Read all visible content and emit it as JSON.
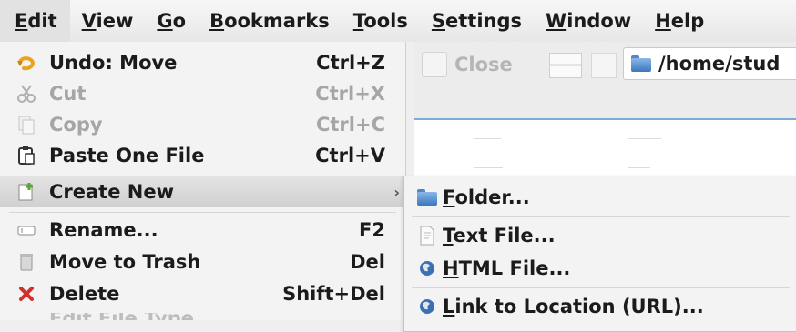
{
  "menubar": {
    "items": [
      "Edit",
      "View",
      "Go",
      "Bookmarks",
      "Tools",
      "Settings",
      "Window",
      "Help"
    ]
  },
  "toolbar": {
    "close_label": "Close",
    "location_path": "/home/stud"
  },
  "edit_menu": {
    "items": [
      {
        "label": "Undo: Move",
        "shortcut": "Ctrl+Z",
        "icon": "undo-icon",
        "enabled": true
      },
      {
        "label": "Cut",
        "shortcut": "Ctrl+X",
        "icon": "scissors-icon",
        "enabled": false
      },
      {
        "label": "Copy",
        "shortcut": "Ctrl+C",
        "icon": "copy-icon",
        "enabled": false
      },
      {
        "label": "Paste One File",
        "shortcut": "Ctrl+V",
        "icon": "paste-icon",
        "enabled": true
      },
      {
        "label": "Create New",
        "shortcut": "",
        "icon": "new-document-icon",
        "enabled": true,
        "submenu": true,
        "highlighted": true
      },
      {
        "label": "Rename...",
        "shortcut": "F2",
        "icon": "rename-icon",
        "enabled": true
      },
      {
        "label": "Move to Trash",
        "shortcut": "Del",
        "icon": "trash-icon",
        "enabled": true
      },
      {
        "label": "Delete",
        "shortcut": "Shift+Del",
        "icon": "delete-icon",
        "enabled": true
      },
      {
        "label": "Edit File Type...",
        "shortcut": "",
        "icon": "",
        "enabled": false
      }
    ]
  },
  "create_new_submenu": {
    "items": [
      {
        "label": "Folder...",
        "icon": "folder-icon"
      },
      {
        "label": "Text File...",
        "icon": "text-file-icon"
      },
      {
        "label": "HTML File...",
        "icon": "html-file-icon"
      },
      {
        "label": "Link to Location (URL)...",
        "icon": "link-icon"
      }
    ]
  },
  "colors": {
    "accent": "#3c77bd",
    "delete_red": "#d0312d",
    "undo_orange": "#e9a321",
    "menu_bg": "#f3f3f3",
    "highlight": "#d0d0d0"
  }
}
